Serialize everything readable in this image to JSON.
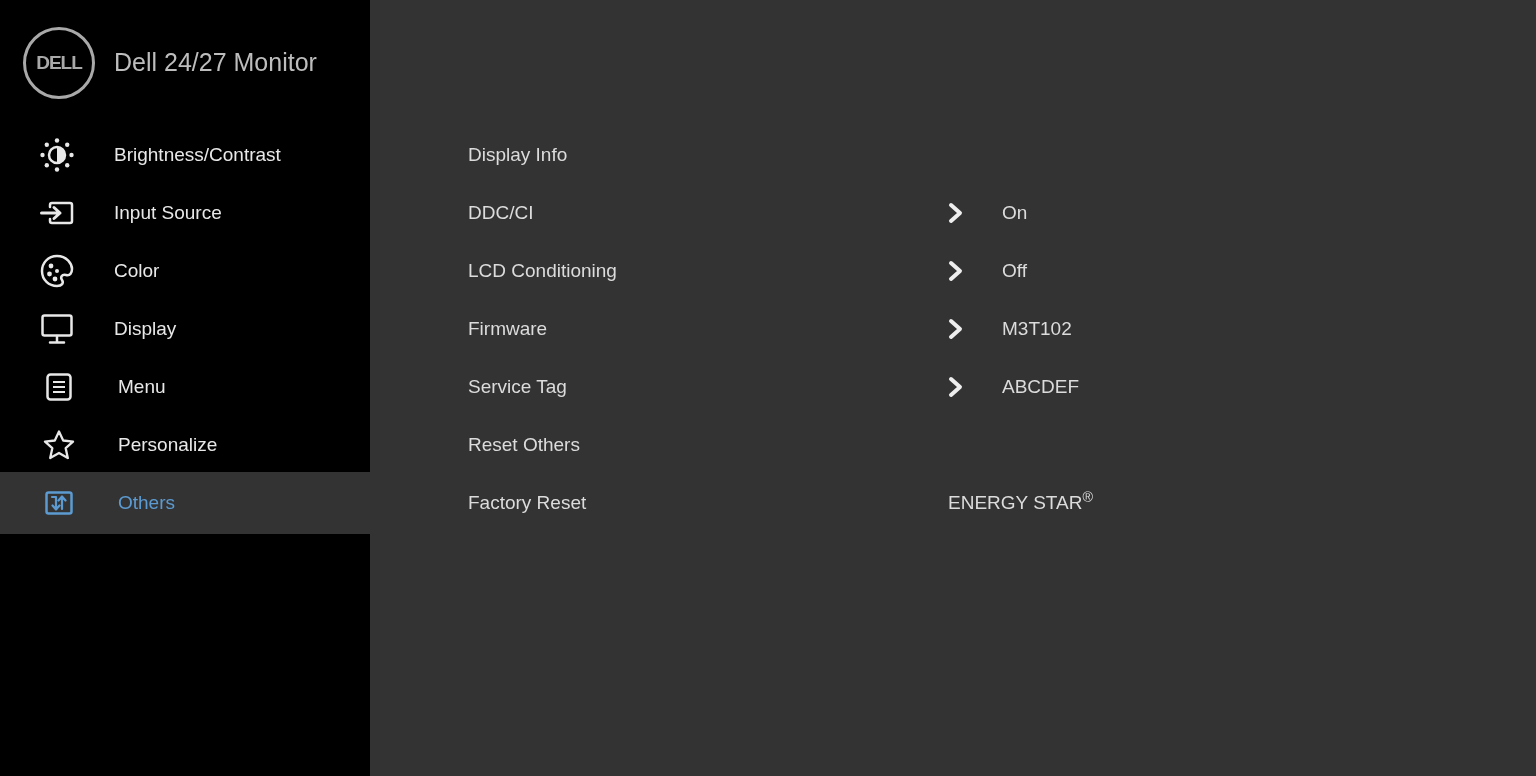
{
  "header": {
    "logo": "DELL",
    "title": "Dell 24/27 Monitor"
  },
  "sidebar": {
    "items": [
      {
        "label": "Brightness/Contrast",
        "selected": false
      },
      {
        "label": "Input Source",
        "selected": false
      },
      {
        "label": "Color",
        "selected": false
      },
      {
        "label": "Display",
        "selected": false
      },
      {
        "label": "Menu",
        "selected": false
      },
      {
        "label": "Personalize",
        "selected": false
      },
      {
        "label": "Others",
        "selected": true
      }
    ]
  },
  "menu": {
    "rows": [
      {
        "kind": "plain",
        "label": "Display Info"
      },
      {
        "kind": "value",
        "label": "DDC/CI",
        "value": "On"
      },
      {
        "kind": "value",
        "label": "LCD Conditioning",
        "value": "Off"
      },
      {
        "kind": "value",
        "label": "Firmware",
        "value": "M3T102"
      },
      {
        "kind": "value",
        "label": "Service Tag",
        "value": "ABCDEF"
      },
      {
        "kind": "plain",
        "label": "Reset Others"
      },
      {
        "kind": "note",
        "label": "Factory Reset",
        "note": "ENERGY STAR$^{®}$"
      }
    ]
  }
}
